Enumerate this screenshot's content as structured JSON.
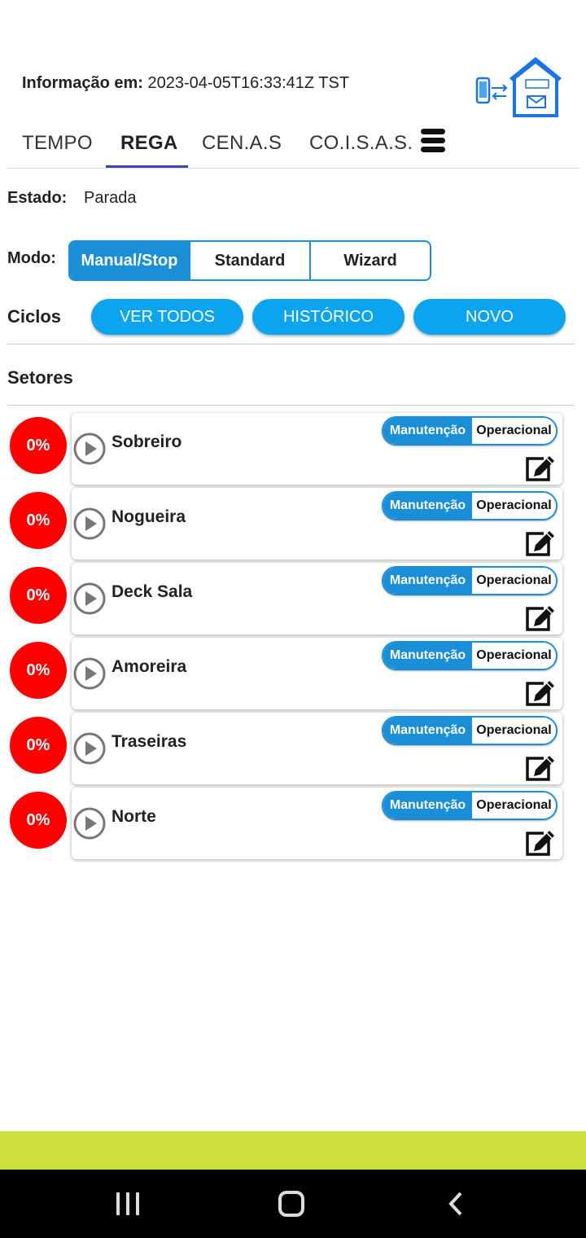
{
  "header": {
    "info_label": "Informação em:",
    "info_value": "2023-04-05T16:33:41Z TST",
    "logo_icon": "house-connect-icon"
  },
  "tabs": [
    {
      "label": "TEMPO",
      "active": false
    },
    {
      "label": "REGA",
      "active": true
    },
    {
      "label": "CEN.A.S",
      "active": false
    },
    {
      "label": "CO.I.S.A.S.",
      "active": false
    }
  ],
  "estado": {
    "label": "Estado:",
    "value": "Parada"
  },
  "modo": {
    "label": "Modo:",
    "options": [
      "Manual/Stop",
      "Standard",
      "Wizard"
    ],
    "selected": "Manual/Stop"
  },
  "ciclos": {
    "label": "Ciclos",
    "buttons": [
      "VER TODOS",
      "HISTÓRICO",
      "NOVO"
    ]
  },
  "setores_title": "Setores",
  "sectors": [
    {
      "percent": "0%",
      "name": "Sobreiro",
      "mode_a": "Manutenção",
      "mode_b": "Operacional"
    },
    {
      "percent": "0%",
      "name": "Nogueira",
      "mode_a": "Manutenção",
      "mode_b": "Operacional"
    },
    {
      "percent": "0%",
      "name": "Deck Sala",
      "mode_a": "Manutenção",
      "mode_b": "Operacional"
    },
    {
      "percent": "0%",
      "name": "Amoreira",
      "mode_a": "Manutenção",
      "mode_b": "Operacional"
    },
    {
      "percent": "0%",
      "name": "Traseiras",
      "mode_a": "Manutenção",
      "mode_b": "Operacional"
    },
    {
      "percent": "0%",
      "name": "Norte",
      "mode_a": "Manutenção",
      "mode_b": "Operacional"
    }
  ],
  "colors": {
    "accent": "#1a8fd8",
    "pill": "#0ca4ee",
    "percent_bg": "#ff0000",
    "bottom_bar": "#cddf3b"
  }
}
